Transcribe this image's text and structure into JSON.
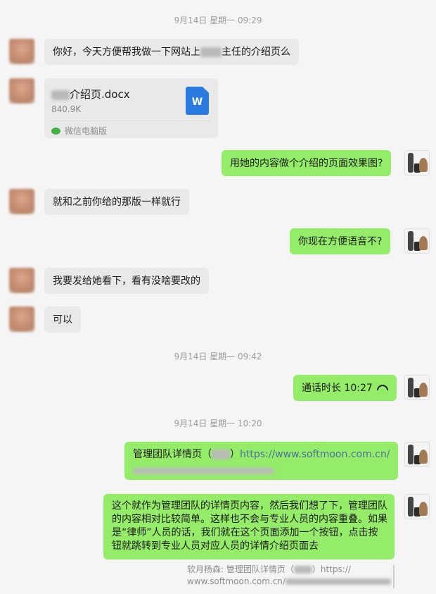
{
  "timestamps": [
    "9月14日 星期一 09:29",
    "9月14日 星期一 09:42",
    "9月14日 星期一 10:20"
  ],
  "messages": {
    "m1": {
      "pre": "你好，今天方便帮我做一下网站上",
      "post": "主任的介绍页么"
    },
    "file": {
      "name": "介绍页.docx",
      "size": "840.9K",
      "source": "微信电脑版",
      "icon": "word-doc-icon",
      "icon_letter": "W"
    },
    "m2": "用她的内容做个介绍的页面效果图?",
    "m3": "就和之前你给的那版一样就行",
    "m4": "你现在方便语音不?",
    "m5": "我要发给她看下，看有没啥要改的",
    "m6": "可以",
    "call": {
      "label": "通话时长 10:27",
      "icon": "phone-hangup-icon"
    },
    "m7": {
      "pre": "管理团队详情页（",
      "post": "）",
      "link": "https://www.softmoon.com.cn/"
    },
    "m8": [
      "这个就作为管理团队的详情页内容，然后我们想了下，管理团队",
      "的内容相对比较简单。这样也不会与专业人员的内容重叠。如果",
      "是“律师”人员的话，我们就在这个页面添加一个按钮，点击按",
      "钮就跳转到专业人员对应人员的详情介绍页面去"
    ],
    "quote": {
      "line1_pre": "软月杨森: 管理团队详情页（",
      "line1_post": "）https://",
      "line2": "www.softmoon.com.cn/"
    }
  },
  "colors": {
    "background": "#f5f5f5",
    "received_bubble": "#e9e9e9",
    "sent_bubble": "#95ec69",
    "word_icon": "#2b7bde",
    "wechat_green": "#43b244"
  }
}
